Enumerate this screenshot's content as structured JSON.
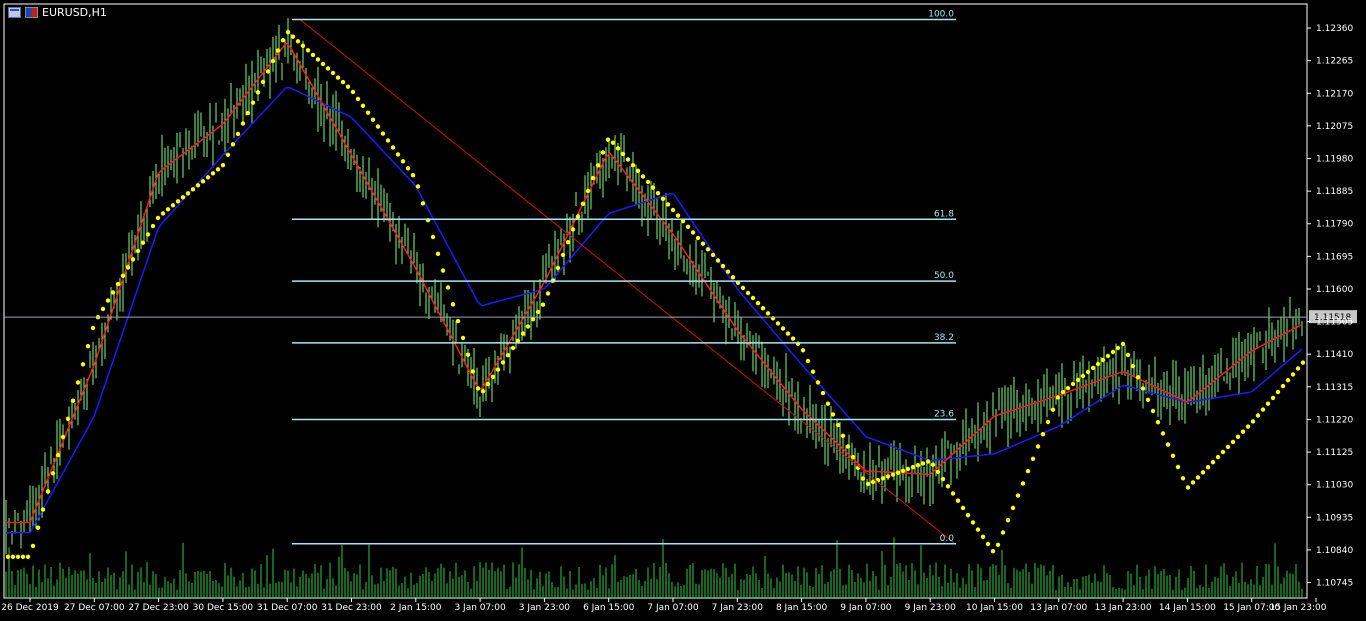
{
  "window": {
    "symbol_title": "EURUSD,H1",
    "icons": [
      "chart-window-icon",
      "currency-flag-icon"
    ]
  },
  "colors": {
    "background": "#000000",
    "candles": "#7CFC7C",
    "volume": "#2ecc40",
    "ma_fast": "#ff1a1a",
    "ma_slow": "#1a1aff",
    "parabolic_sar": "#ffff00",
    "fibonacci": "#a6e6f0",
    "trendline": "#cc1010",
    "axis_text": "#ffffff",
    "current_price_bg": "#c8c8c8"
  },
  "price_axis": {
    "labels": [
      "1.12360",
      "1.12265",
      "1.12170",
      "1.12075",
      "1.11980",
      "1.11885",
      "1.11790",
      "1.11695",
      "1.11600",
      "1.11505",
      "1.11410",
      "1.11315",
      "1.11220",
      "1.11125",
      "1.11030",
      "1.10935",
      "1.10840",
      "1.10745"
    ],
    "current_price": "1.11518"
  },
  "time_axis": {
    "labels": [
      "26 Dec 2019",
      "27 Dec 07:00",
      "27 Dec 23:00",
      "30 Dec 15:00",
      "31 Dec 07:00",
      "31 Dec 23:00",
      "2 Jan 15:00",
      "3 Jan 07:00",
      "3 Jan 23:00",
      "6 Jan 15:00",
      "7 Jan 07:00",
      "7 Jan 23:00",
      "8 Jan 15:00",
      "9 Jan 07:00",
      "9 Jan 23:00",
      "10 Jan 15:00",
      "13 Jan 07:00",
      "13 Jan 23:00",
      "14 Jan 15:00",
      "15 Jan 07:00",
      "15 Jan 23:00"
    ]
  },
  "fibonacci": {
    "levels": [
      {
        "label": "100.0",
        "price": 1.12385
      },
      {
        "label": "61.8",
        "price": 1.11803
      },
      {
        "label": "50.0",
        "price": 1.11623
      },
      {
        "label": "38.2",
        "price": 1.11443
      },
      {
        "label": "23.6",
        "price": 1.1122
      },
      {
        "label": "0.0",
        "price": 1.10858
      }
    ]
  },
  "chart_data": {
    "type": "line",
    "title": "EURUSD,H1",
    "xlabel": "",
    "ylabel": "",
    "ylim": [
      1.107,
      1.1243
    ],
    "grid": false,
    "x": [
      "26 Dec 2019",
      "27 Dec 07:00",
      "27 Dec 23:00",
      "30 Dec 15:00",
      "31 Dec 07:00",
      "31 Dec 23:00",
      "2 Jan 15:00",
      "3 Jan 07:00",
      "3 Jan 23:00",
      "6 Jan 15:00",
      "7 Jan 07:00",
      "7 Jan 23:00",
      "8 Jan 15:00",
      "9 Jan 07:00",
      "9 Jan 23:00",
      "10 Jan 15:00",
      "13 Jan 07:00",
      "13 Jan 23:00",
      "14 Jan 15:00",
      "15 Jan 07:00",
      "15 Jan 23:00"
    ],
    "series": [
      {
        "values": [
          1.1092,
          1.1138,
          1.1194,
          1.1208,
          1.1232,
          1.1199,
          1.1166,
          1.113,
          1.1162,
          1.12,
          1.1176,
          1.1148,
          1.1125,
          1.1107,
          1.1106,
          1.1123,
          1.1129,
          1.1136,
          1.1127,
          1.1142,
          1.11518
        ]
      },
      {
        "values": [
          1.1089,
          1.1123,
          1.1178,
          1.1199,
          1.1219,
          1.121,
          1.119,
          1.1155,
          1.116,
          1.1182,
          1.1188,
          1.116,
          1.1138,
          1.1117,
          1.111,
          1.1112,
          1.112,
          1.1132,
          1.1127,
          1.113,
          1.1146
        ]
      },
      {
        "values": [
          1.1082,
          1.115,
          1.1181,
          1.1196,
          1.1235,
          1.1218,
          1.1192,
          1.1129,
          1.1156,
          1.1204,
          1.1183,
          1.1162,
          1.1143,
          1.1103,
          1.111,
          1.1083,
          1.1129,
          1.1144,
          1.1102,
          1.1121,
          1.1143
        ]
      }
    ]
  }
}
